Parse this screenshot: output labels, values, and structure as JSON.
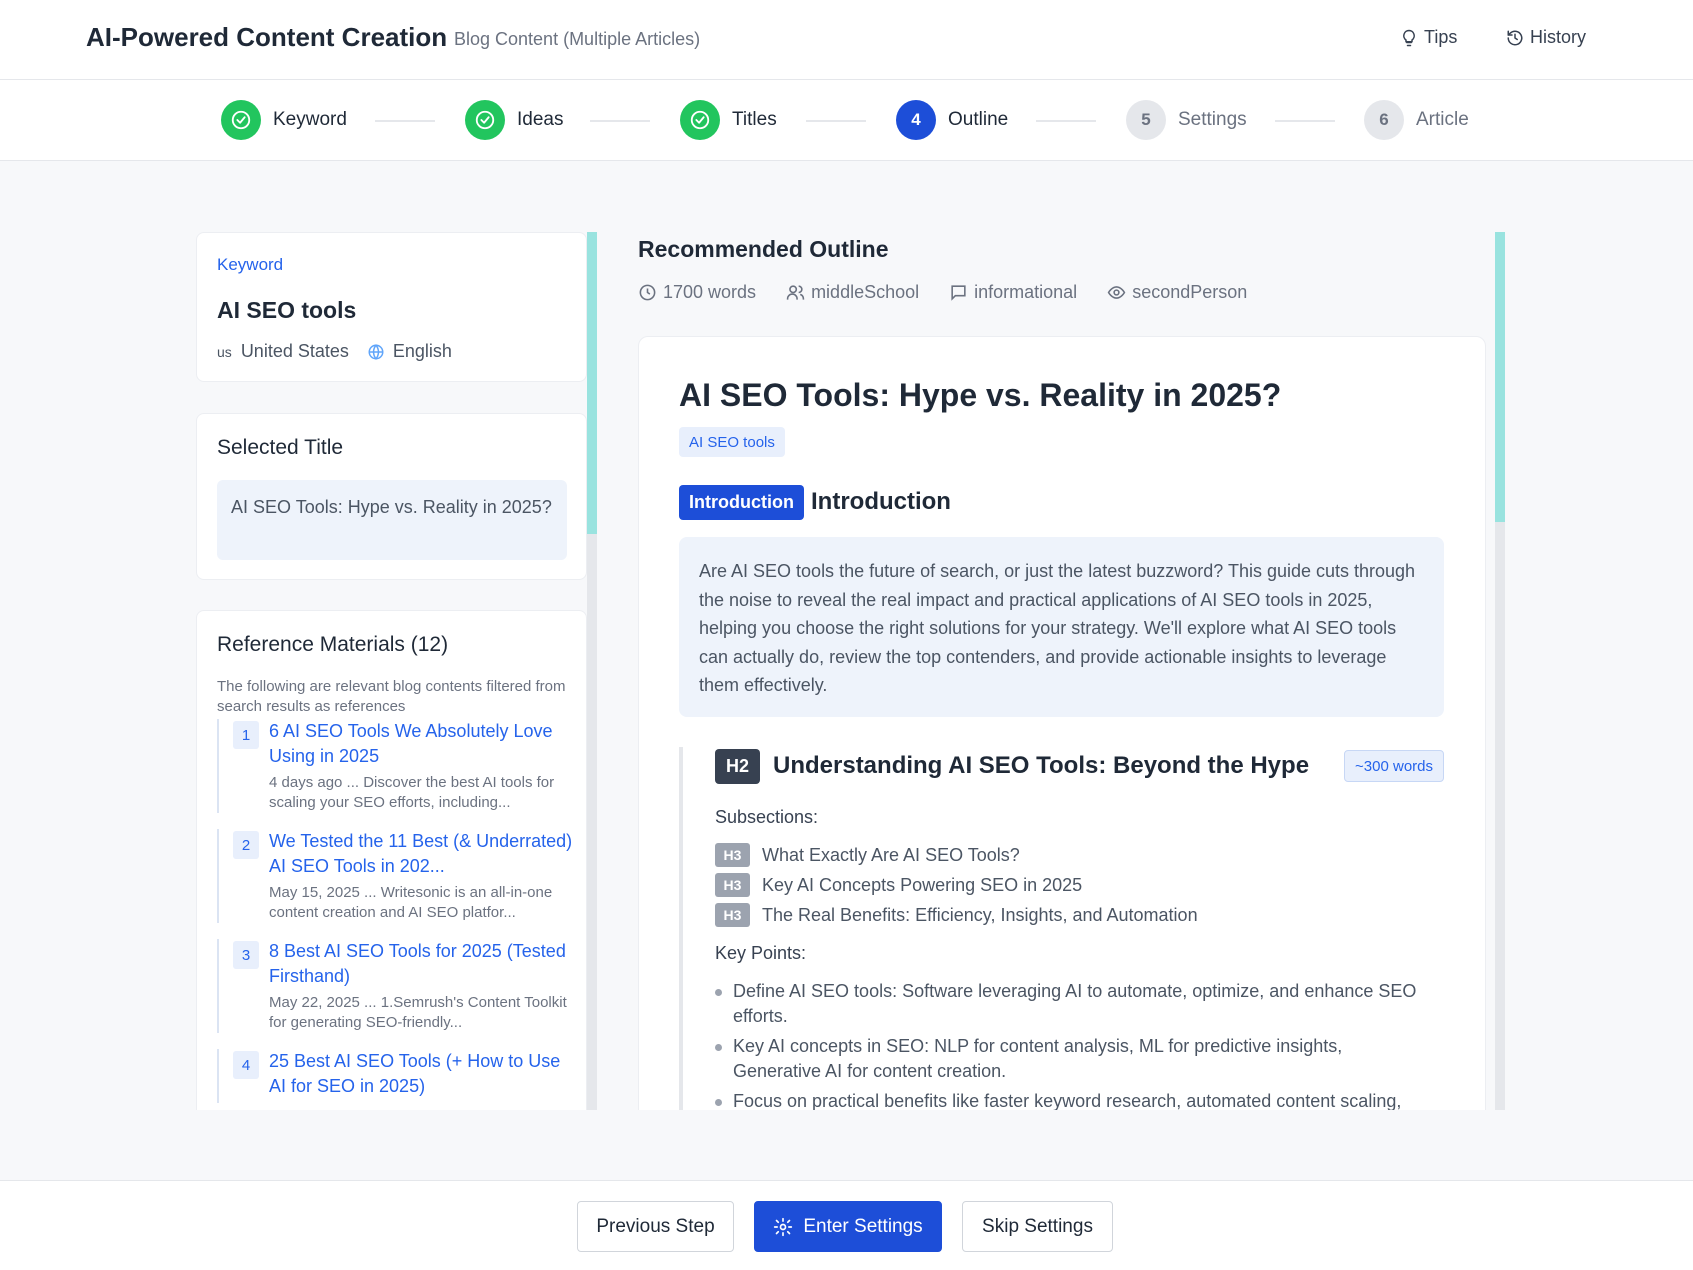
{
  "header": {
    "title": "AI-Powered Content Creation",
    "subtitle": "Blog Content (Multiple Articles)",
    "tips_label": "Tips",
    "history_label": "History"
  },
  "stepper": {
    "steps": [
      {
        "number": "1",
        "label": "Keyword",
        "status": "done"
      },
      {
        "number": "2",
        "label": "Ideas",
        "status": "done"
      },
      {
        "number": "3",
        "label": "Titles",
        "status": "done"
      },
      {
        "number": "4",
        "label": "Outline",
        "status": "active"
      },
      {
        "number": "5",
        "label": "Settings",
        "status": "pending"
      },
      {
        "number": "6",
        "label": "Article",
        "status": "pending"
      }
    ]
  },
  "keyword_card": {
    "label": "Keyword",
    "value": "AI SEO tools",
    "country_code": "us",
    "country": "United States",
    "language": "English"
  },
  "selected_title": {
    "heading": "Selected Title",
    "text": "AI SEO Tools: Hype vs. Reality in 2025?"
  },
  "references": {
    "heading": "Reference Materials (12)",
    "description": "The following are relevant blog contents filtered from search results as references",
    "items": [
      {
        "num": "1",
        "title": "6 AI SEO Tools We Absolutely Love Using in 2025",
        "snippet": "4 days ago ... Discover the best AI tools for scaling your SEO efforts, including..."
      },
      {
        "num": "2",
        "title": "We Tested the 11 Best (& Underrated) AI SEO Tools in 202...",
        "snippet": "May 15, 2025 ... Writesonic is an all-in-one content creation and AI SEO platfor..."
      },
      {
        "num": "3",
        "title": "8 Best AI SEO Tools for 2025 (Tested Firsthand)",
        "snippet": "May 22, 2025 ... 1.Semrush's Content Toolkit for generating SEO-friendly..."
      },
      {
        "num": "4",
        "title": "25 Best AI SEO Tools (+ How to Use AI for SEO in 2025)",
        "snippet": ""
      }
    ]
  },
  "outline": {
    "heading": "Recommended Outline",
    "meta": {
      "words": "1700 words",
      "audience": "middleSchool",
      "intent": "informational",
      "perspective": "secondPerson"
    },
    "article_title": "AI SEO Tools: Hype vs. Reality in 2025?",
    "keyword_tag": "AI SEO tools",
    "intro_badge": "Introduction",
    "intro_heading": "Introduction",
    "intro_text": "Are AI SEO tools the future of search, or just the latest buzzword? This guide cuts through the noise to reveal the real impact and practical applications of AI SEO tools in 2025, helping you choose the right solutions for your strategy. We'll explore what AI SEO tools can actually do, review the top contenders, and provide actionable insights to leverage them effectively.",
    "section": {
      "badge": "H2",
      "title": "Understanding AI SEO Tools: Beyond the Hype",
      "words": "~300 words",
      "subsections_label": "Subsections:",
      "subsections": [
        {
          "badge": "H3",
          "text": "What Exactly Are AI SEO Tools?"
        },
        {
          "badge": "H3",
          "text": "Key AI Concepts Powering SEO in 2025"
        },
        {
          "badge": "H3",
          "text": "The Real Benefits: Efficiency, Insights, and Automation"
        }
      ],
      "key_points_label": "Key Points:",
      "key_points": [
        "Define AI SEO tools: Software leveraging AI to automate, optimize, and enhance SEO efforts.",
        "Key AI concepts in SEO: NLP for content analysis, ML for predictive insights, Generative AI for content creation.",
        "Focus on practical benefits like faster keyword research, automated content scaling,"
      ]
    }
  },
  "footer": {
    "previous_label": "Previous Step",
    "enter_settings_label": "Enter Settings",
    "skip_settings_label": "Skip Settings"
  },
  "colors": {
    "accent": "#1d4ed8",
    "success": "#22c55e",
    "link": "#2563eb",
    "scroll_thumb": "#99e3df"
  }
}
